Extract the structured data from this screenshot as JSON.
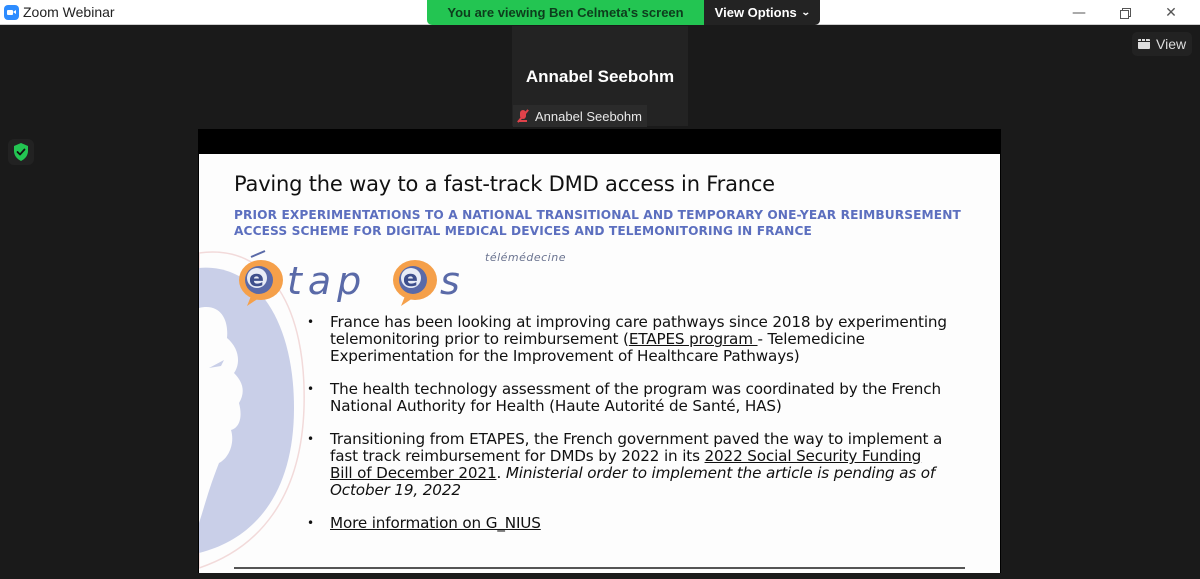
{
  "window": {
    "app_title": "Zoom Webinar",
    "controls": {
      "minimize": "—",
      "close": "✕"
    }
  },
  "share_banner": {
    "status_text": "You are viewing Ben Celmeta's screen",
    "view_options_label": "View Options",
    "view_options_chevron": "⌄",
    "status_color": "#23c552"
  },
  "view_button": {
    "label": "View",
    "icon": "grid-view-icon"
  },
  "speaker": {
    "display_name": "Annabel Seebohm",
    "name_tag": "Annabel Seebohm",
    "mic_state": "muted",
    "mic_icon_color": "#e0424a"
  },
  "security_icon": {
    "name": "shield-check-icon",
    "color": "#23c552"
  },
  "slide": {
    "title": "Paving the way to a fast-track DMD access in France",
    "subtitle": "PRIOR EXPERIMENTATIONS TO A NATIONAL TRANSITIONAL AND TEMPORARY ONE-YEAR REIMBURSEMENT ACCESS SCHEME FOR DIGITAL MEDICAL DEVICES AND TELEMONITORING IN FRANCE",
    "subtitle_color": "#5c6fbf",
    "logo": {
      "text": "étapes",
      "tagline": "télémédecine",
      "accent_color": "#f5a04a"
    },
    "bullets": [
      {
        "pre": "France has been looking at improving care pathways since 2018 by experimenting telemonitoring prior to reimbursement (",
        "link": "ETAPES program ",
        "post": "- Telemedicine Experimentation for the Improvement of Healthcare Pathways)"
      },
      {
        "text": "The health technology assessment of the program was coordinated by the French National Authority for Health (Haute Autorité de Santé, HAS)"
      },
      {
        "pre": "Transitioning from ETAPES, the French government paved the way to implement a fast track reimbursement for DMDs by 2022 in its ",
        "link": "2022 Social Security Funding Bill of December 2021",
        "post": ". ",
        "italic": "Ministerial order to implement the article is pending as of October 19, 2022"
      },
      {
        "link": "More information on G_NIUS"
      }
    ]
  }
}
